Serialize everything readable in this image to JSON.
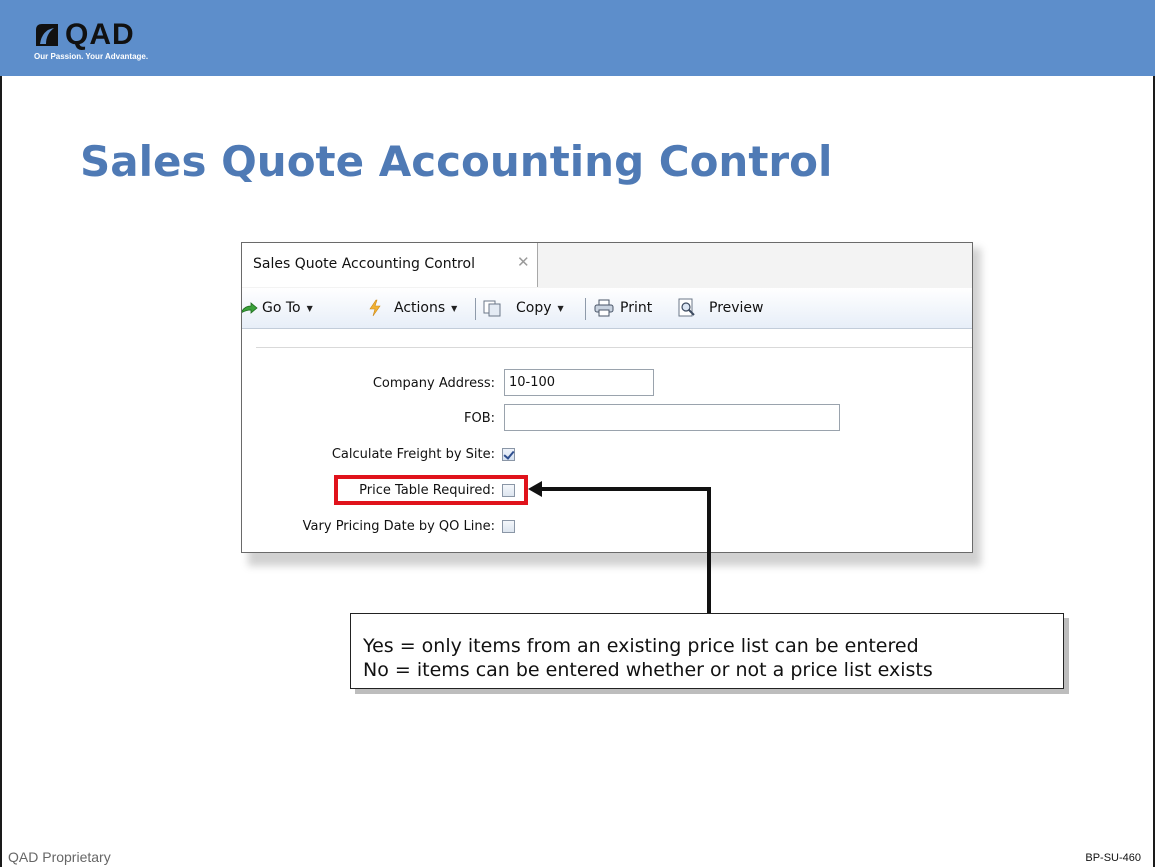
{
  "brand": {
    "logo_text": "QAD",
    "tagline": "Our Passion. Your Advantage.",
    "header_color": "#5d8ecb"
  },
  "slide": {
    "title": "Sales Quote Accounting Control",
    "title_color": "#4f7ab5"
  },
  "window": {
    "tab": {
      "label": "Sales Quote Accounting Control",
      "close_glyph": "✕"
    },
    "toolbar": {
      "goto": "Go To",
      "actions": "Actions",
      "copy": "Copy",
      "print": "Print",
      "preview": "Preview"
    },
    "form": {
      "company_address": {
        "label": "Company Address:",
        "value": "10-100"
      },
      "fob": {
        "label": "FOB:",
        "value": ""
      },
      "calc_freight": {
        "label": "Calculate Freight by Site:",
        "checked": true
      },
      "price_table": {
        "label": "Price Table Required:",
        "checked": false
      },
      "vary_pricing": {
        "label": "Vary Pricing Date by QO Line:",
        "checked": false
      }
    }
  },
  "callout": {
    "line1": "Yes = only items from an existing price list can be entered",
    "line2": "No = items can be entered whether or not a price list exists",
    "highlight_color": "#e0121b"
  },
  "footer": {
    "left": "QAD Proprietary",
    "right": "BP-SU-460"
  }
}
